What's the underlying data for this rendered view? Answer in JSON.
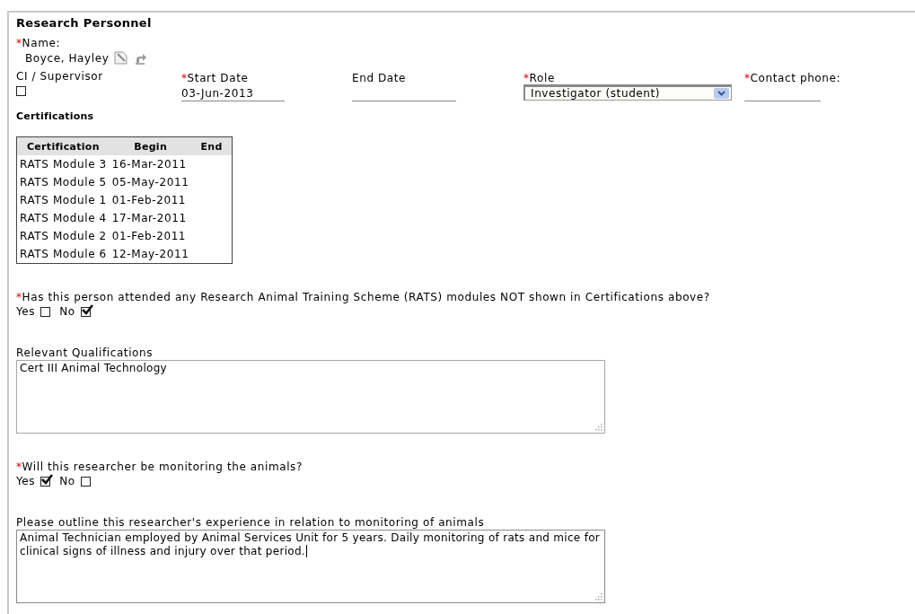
{
  "title": "Research Personnel",
  "required_mark": "*",
  "name": {
    "label": "Name:",
    "required": true,
    "value": "Boyce, Hayley"
  },
  "fields": [
    {
      "kind": "checkbox",
      "label": "CI / Supervisor",
      "required": false,
      "checked": false
    },
    {
      "kind": "text",
      "label": "Start Date",
      "required": true,
      "value": "03-Jun-2013"
    },
    {
      "kind": "text",
      "label": "End Date",
      "required": false
    },
    {
      "kind": "select",
      "label": "Role",
      "required": true,
      "value": "Investigator (student)"
    },
    {
      "kind": "text",
      "label": "Contact phone:",
      "required": true
    }
  ],
  "certifications": {
    "heading": "Certifications",
    "columns": [
      "Certification",
      "Begin",
      "End"
    ],
    "rows": [
      [
        "RATS Module 3",
        "16-Mar-2011"
      ],
      [
        "RATS Module 5",
        "05-May-2011"
      ],
      [
        "RATS Module 1",
        "01-Feb-2011"
      ],
      [
        "RATS Module 4",
        "17-Mar-2011"
      ],
      [
        "RATS Module 2",
        "01-Feb-2011"
      ],
      [
        "RATS Module 6",
        "12-May-2011"
      ]
    ]
  },
  "sections": [
    {
      "kind": "question",
      "question": "Has this person attended any Research Animal Training Scheme (RATS) modules NOT shown in Certifications above?",
      "required": true,
      "options": [
        {
          "label": "Yes",
          "checked": false
        },
        {
          "label": "No",
          "checked": true
        }
      ]
    },
    {
      "kind": "textarea",
      "label": "Relevant Qualifications",
      "value": "Cert III Animal Technology",
      "focused": false
    },
    {
      "kind": "question",
      "question": "Will this researcher be monitoring the animals?",
      "required": true,
      "options": [
        {
          "label": "Yes",
          "checked": true
        },
        {
          "label": "No",
          "checked": false
        }
      ]
    },
    {
      "kind": "textarea",
      "label": "Please outline this researcher's experience in relation to monitoring of animals",
      "value": "Animal Technician employed by Animal Services Unit for 5 years. Daily monitoring of rats and mice for clinical signs of illness and injury over that period.",
      "focused": true
    }
  ]
}
